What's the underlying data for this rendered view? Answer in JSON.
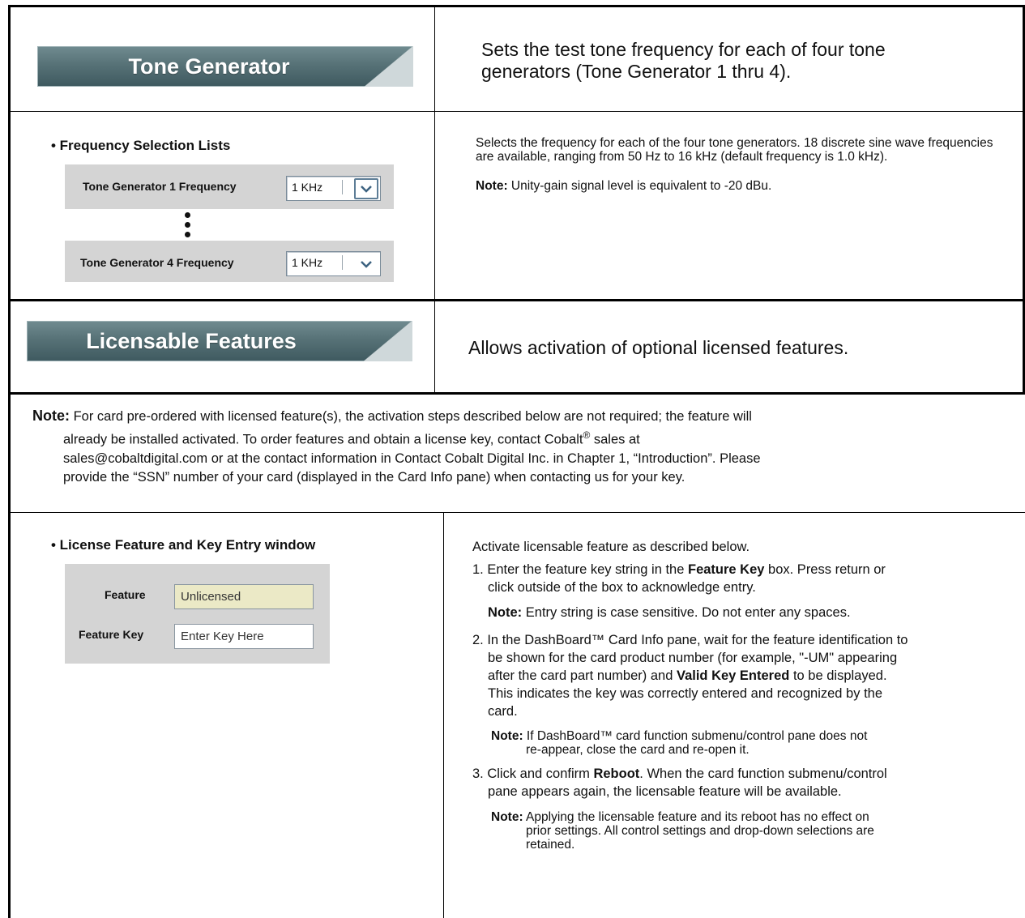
{
  "tone_section": {
    "header": "Tone Generator",
    "description": "Sets the test tone frequency for each of four tone generators (Tone Generator 1 thru 4).",
    "frequency_lists": {
      "title": "• Frequency Selection Lists",
      "gen1_label": "Tone Generator 1 Frequency",
      "gen1_value": "1 KHz",
      "gen4_label": "Tone Generator 4 Frequency",
      "gen4_value": "1 KHz"
    },
    "frequency_text": "Selects the frequency for each of the four tone generators. 18 discrete sine wave frequencies are available, ranging from 50 Hz to 16 kHz (default frequency is 1.0 kHz).",
    "note_label": "Note:",
    "note_text": " Unity-gain signal level is equivalent to -20 dBu."
  },
  "license_section": {
    "header": "Licensable Features",
    "description": "Allows activation of optional licensed features.",
    "note_label": "Note:",
    "note_line1": " For card pre-ordered with licensed feature(s), the activation steps described below are not required; the feature will",
    "note_line2a": "already be installed activated. To order features and obtain a license key, contact Cobalt",
    "note_reg": "®",
    "note_line2b": " sales at",
    "note_line3": "sales@cobaltdigital.com or at the contact information in Contact Cobalt Digital Inc. in Chapter 1, “Introduction”. Please",
    "note_line4": "provide the “SSN” number of your card (displayed in the Card Info pane) when contacting us for your key.",
    "window": {
      "title": "• License Feature and Key Entry window",
      "feature_label": "Feature",
      "feature_value": "Unlicensed",
      "key_label": "Feature Key",
      "key_value": "Enter Key Here"
    },
    "steps_intro": "Activate licensable feature as described below.",
    "step1_a": "1. Enter the feature key string in the ",
    "step1_b": "Feature Key",
    "step1_c": " box. Press return or",
    "step1_d": "click outside of the box to acknowledge entry.",
    "step1_note_label": "Note:",
    "step1_note": " Entry string is case sensitive. Do not enter any spaces.",
    "step2_a": "2. In the DashBoard™ Card Info pane, wait for the feature identification to",
    "step2_b": "be shown for the card product number (for example, \"-UM\" appearing",
    "step2_c1": "after the card part number) and ",
    "step2_c2": "Valid Key Entered",
    "step2_c3": " to be displayed.",
    "step2_d": "This indicates the key was correctly entered and recognized by the",
    "step2_e": "card.",
    "step2_note_label": "Note:",
    "step2_note_a": " If DashBoard™ card function submenu/control pane does not",
    "step2_note_b": "re-appear, close the card and re-open it.",
    "step3_a1": "3. Click and confirm ",
    "step3_a2": "Reboot",
    "step3_a3": ". When the card function submenu/control",
    "step3_b": "pane appears again, the licensable feature will be available.",
    "step3_note_label": "Note:",
    "step3_note_a": " Applying the licensable feature and its reboot has no effect on",
    "step3_note_b": "prior settings. All control settings and drop-down selections are",
    "step3_note_c": "retained."
  }
}
